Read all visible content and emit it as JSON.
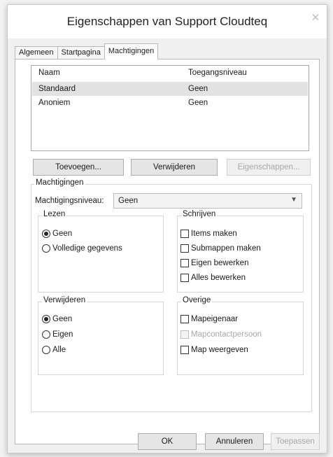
{
  "window": {
    "title": "Eigenschappen van Support Cloudteq",
    "close_label": "✕"
  },
  "tabs": [
    {
      "label": "Algemeen",
      "active": false
    },
    {
      "label": "Startpagina",
      "active": false
    },
    {
      "label": "Machtigingen",
      "active": true
    }
  ],
  "permissions_list": {
    "columns": [
      "Naam",
      "Toegangsniveau"
    ],
    "rows": [
      {
        "name": "Standaard",
        "level": "Geen",
        "selected": true
      },
      {
        "name": "Anoniem",
        "level": "Geen",
        "selected": false
      }
    ]
  },
  "list_buttons": {
    "add": "Toevoegen...",
    "remove": "Verwijderen",
    "properties": "Eigenschappen..."
  },
  "permissions_group": {
    "label": "Machtigingen",
    "level_label": "Machtigingsniveau:",
    "level_value": "Geen"
  },
  "read_group": {
    "label": "Lezen",
    "options": [
      "Geen",
      "Volledige gegevens"
    ],
    "selected": "Geen"
  },
  "write_group": {
    "label": "Schrijven",
    "options": [
      "Items maken",
      "Submappen maken",
      "Eigen bewerken",
      "Alles bewerken"
    ]
  },
  "delete_group": {
    "label": "Verwijderen",
    "options": [
      "Geen",
      "Eigen",
      "Alle"
    ],
    "selected": "Geen"
  },
  "other_group": {
    "label": "Overige",
    "options": [
      "Mapeigenaar",
      "Mapcontactpersoon",
      "Map weergeven"
    ],
    "disabled": "Mapcontactpersoon"
  },
  "footer": {
    "ok": "OK",
    "cancel": "Annuleren",
    "apply": "Toepassen"
  }
}
